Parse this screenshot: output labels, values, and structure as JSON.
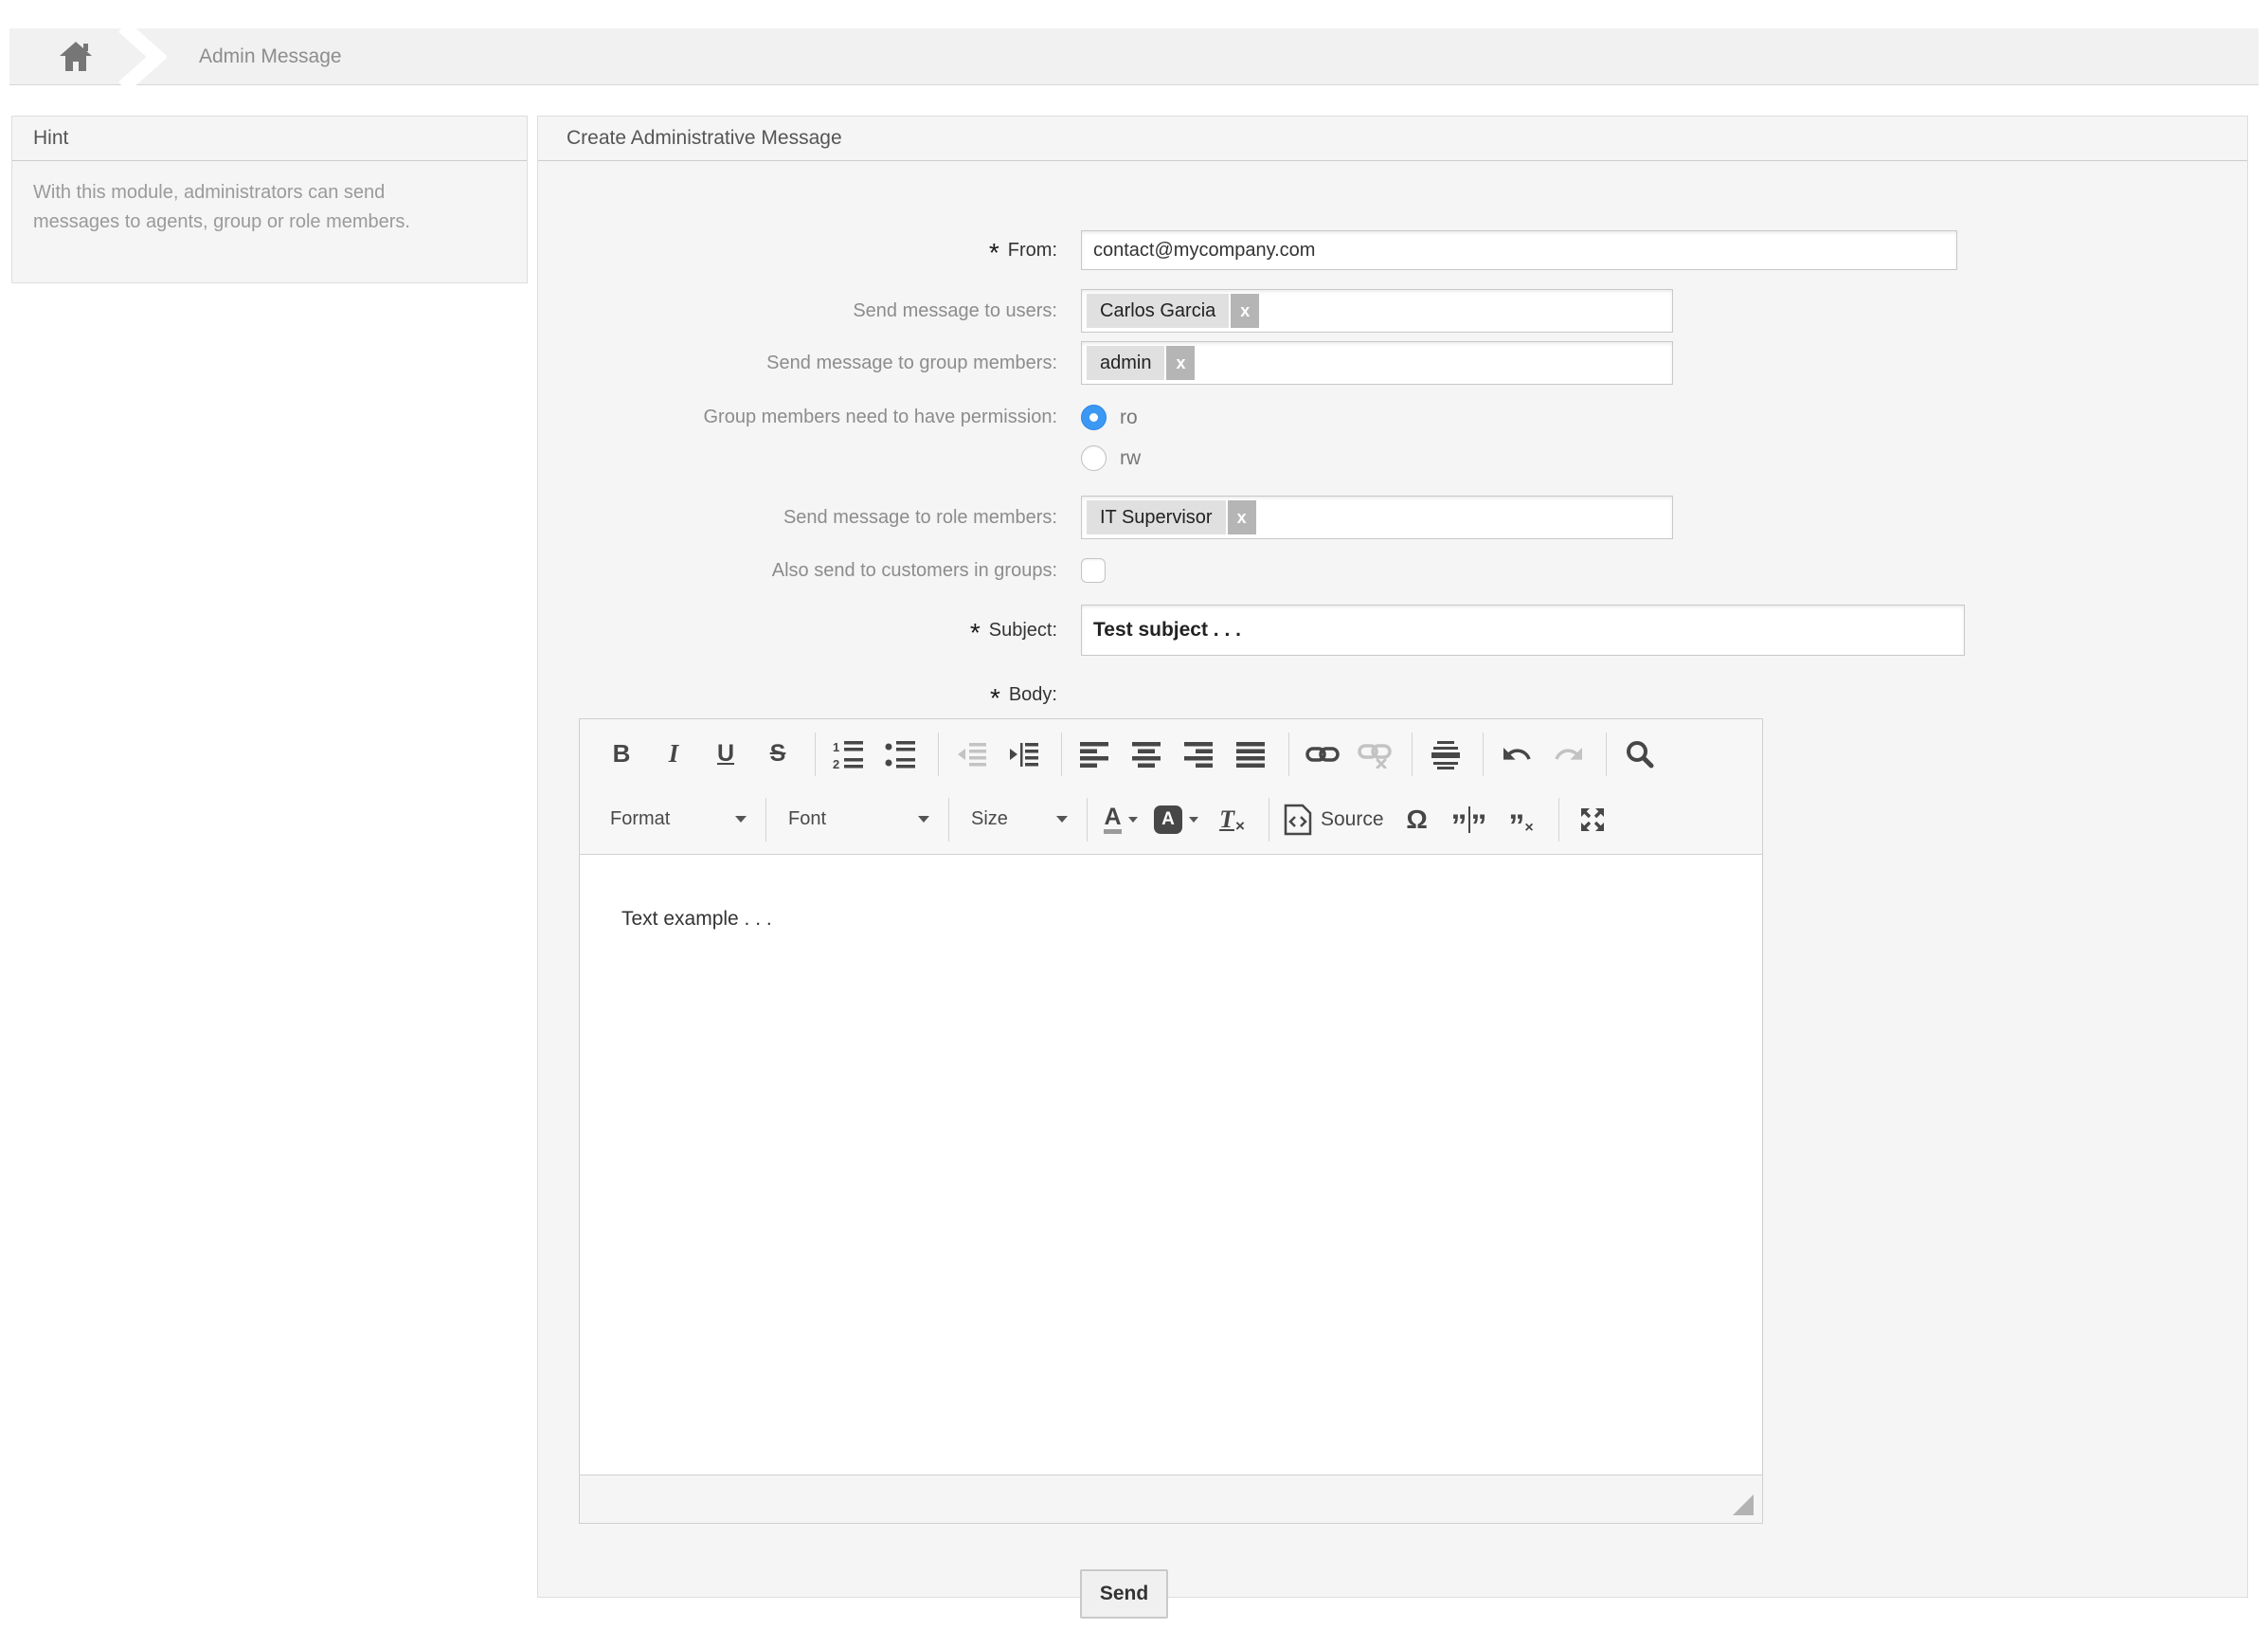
{
  "breadcrumb": {
    "title": "Admin Message"
  },
  "hint": {
    "title": "Hint",
    "text": "With this module, administrators can send messages to agents, group or role members."
  },
  "panel": {
    "title": "Create Administrative Message"
  },
  "form": {
    "required_marker": "*",
    "from_label": "From:",
    "from_value": "contact@mycompany.com",
    "users_label": "Send message to users:",
    "users_tag": "Carlos Garcia",
    "groups_label": "Send message to group members:",
    "groups_tag": "admin",
    "tag_remove": "x",
    "permission_label": "Group members need to have permission:",
    "permission_options": [
      {
        "label": "ro",
        "selected": true
      },
      {
        "label": "rw",
        "selected": false
      }
    ],
    "roles_label": "Send message to role members:",
    "roles_tag": "IT Supervisor",
    "customers_label": "Also send to customers in groups:",
    "customers_checked": false,
    "subject_label": "Subject:",
    "subject_value": "Test subject . . .",
    "body_label": "Body:",
    "body_value": "Text example . . .",
    "send_label": "Send"
  },
  "editor": {
    "combos": {
      "format": "Format",
      "font": "Font",
      "size": "Size"
    },
    "source_label": "Source",
    "glyphs": {
      "bold": "B",
      "italic": "I",
      "underline": "U",
      "strike": "S",
      "text_color": "A",
      "bg_color": "A",
      "remove_format_t": "T",
      "remove_format_x": "×",
      "omega": "Ω",
      "quote": "”",
      "quote_x": "×"
    },
    "toolbar_row1": [
      "bold",
      "italic",
      "underline",
      "strike",
      "numbered-list",
      "bulleted-list",
      "outdent(disabled)",
      "indent",
      "align-left",
      "align-center",
      "align-right",
      "justify",
      "link",
      "unlink(disabled)",
      "horizontal-rule",
      "undo",
      "redo(disabled)",
      "find"
    ],
    "toolbar_row2": [
      "format-combo",
      "font-combo",
      "size-combo",
      "text-color",
      "background-color",
      "remove-format",
      "source",
      "special-character",
      "split-quote",
      "remove-quote",
      "maximize"
    ]
  },
  "colors": {
    "accent_blue": "#3b99f4",
    "panel_bg": "#f5f5f5",
    "tag_bg": "#e0e0e0",
    "tag_remove_bg": "#b5b5b5",
    "icon": "#474747",
    "icon_disabled": "#c3c3c3"
  }
}
